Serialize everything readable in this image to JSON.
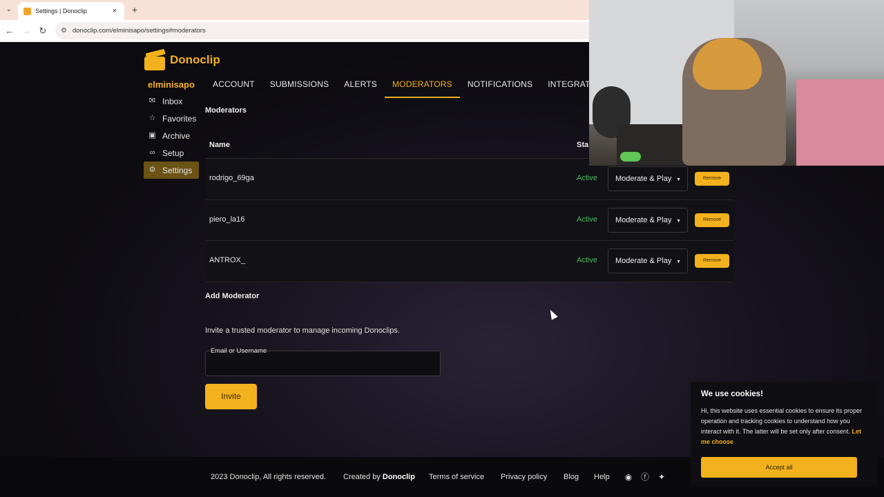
{
  "browser": {
    "tab_title": "Settings | Donoclip",
    "url": "donoclip.com/elminisapo/settings#moderators"
  },
  "app": {
    "brand": "Donoclip",
    "username": "elminisapo",
    "accent": "#f3b11d"
  },
  "sidebar": {
    "items": [
      {
        "label": "Inbox",
        "icon": "inbox-icon"
      },
      {
        "label": "Favorites",
        "icon": "star-icon"
      },
      {
        "label": "Archive",
        "icon": "archive-icon"
      },
      {
        "label": "Setup",
        "icon": "link-icon"
      },
      {
        "label": "Settings",
        "icon": "gear-icon",
        "active": true
      }
    ]
  },
  "tabs": [
    {
      "label": "ACCOUNT"
    },
    {
      "label": "SUBMISSIONS"
    },
    {
      "label": "ALERTS"
    },
    {
      "label": "MODERATORS",
      "active": true
    },
    {
      "label": "NOTIFICATIONS"
    },
    {
      "label": "INTEGRATIONS"
    }
  ],
  "moderators": {
    "section_title": "Moderators",
    "columns": {
      "name": "Name",
      "status": "Sta"
    },
    "rows": [
      {
        "name": "rodrigo_69ga",
        "status": "Active",
        "role": "Moderate & Play",
        "remove_label": "Remove"
      },
      {
        "name": "piero_la16",
        "status": "Active",
        "role": "Moderate & Play",
        "remove_label": "Remove"
      },
      {
        "name": "ANTROX_",
        "status": "Active",
        "role": "Moderate & Play",
        "remove_label": "Remove"
      }
    ]
  },
  "add_moderator": {
    "title": "Add Moderator",
    "description": "Invite a trusted moderator to manage incoming Donoclips.",
    "field_label": "Email or Username",
    "field_value": "",
    "invite_label": "Invite"
  },
  "footer": {
    "copyright": "2023 Donoclip, All rights reserved.",
    "created_by_prefix": "Created by",
    "created_by_name": "Donoclip",
    "terms": "Terms of service",
    "privacy": "Privacy policy",
    "blog": "Blog",
    "help": "Help"
  },
  "cookie_banner": {
    "title": "We use cookies!",
    "text": "Hi, this website uses essential cookies to ensure its proper operation and tracking cookies to understand how you interact with it. The latter will be set only after consent.",
    "link": "Let me choose",
    "accept_label": "Accept all"
  }
}
